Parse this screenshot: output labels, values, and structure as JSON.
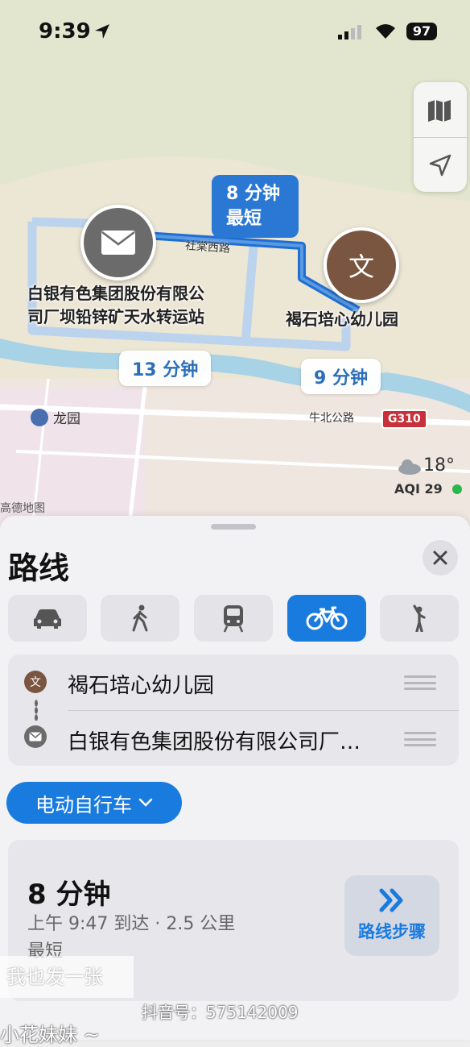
{
  "status_bar": {
    "time": "9:39",
    "battery": "97"
  },
  "map": {
    "origin_label_line1": "白银有色集团股份有限公",
    "origin_label_line2": "司厂坝铅锌矿天水转运站",
    "dest_label": "褐石培心幼儿园",
    "dest_icon_char": "文",
    "route_main_time": "8 分钟",
    "route_main_tag": "最短",
    "route_alt1_time": "13 分钟",
    "route_alt2_time": "9 分钟",
    "street1": "社棠西路",
    "street2": "牛北公路",
    "highway_badge": "G310",
    "poi_park": "龙园",
    "map_credit": "高德地图",
    "weather_temp": "18°",
    "aqi_label": "AQI 29",
    "aqi_color": "#2bb84a"
  },
  "sheet": {
    "title": "路线",
    "modes": [
      "car-icon",
      "walk-icon",
      "transit-icon",
      "bike-icon",
      "ride-share-icon"
    ],
    "selected_mode": "bike",
    "stop1": "褐石培心幼儿园",
    "stop1_icon_char": "文",
    "stop2": "白银有色集团股份有限公司厂…",
    "ebike_label": "电动自行车",
    "route": {
      "duration": "8 分钟",
      "arrival": "上午 9:47 到达 · 2.5 公里",
      "tag": "最短",
      "steps_label": "路线步骤"
    }
  },
  "overlay": {
    "comment": "我也发一张",
    "douyin_id": "抖音号：575142009",
    "username": "小花妹妹 ~"
  },
  "colors": {
    "accent": "#1a7bdf",
    "route_line": "#1f6fd1",
    "brown_pin": "#7a5540",
    "gray_pin": "#6b6b6b"
  }
}
